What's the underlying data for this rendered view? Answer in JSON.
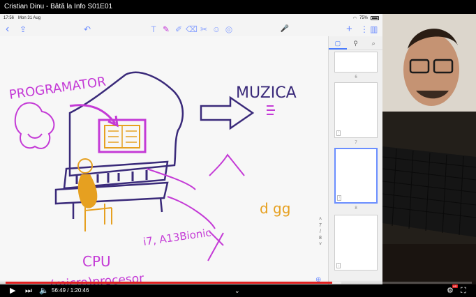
{
  "video": {
    "title": "Cristian Dinu - Bâtă la Info S01E01",
    "current_time": "56:49",
    "duration": "1:20:46",
    "played_fraction": 0.7,
    "loaded_fraction": 0.72
  },
  "ipad": {
    "status_time": "17:56",
    "status_date": "Mon 31 Aug",
    "battery": "75%"
  },
  "toolbar": {
    "back": "‹",
    "share": "⇪",
    "undo": "↶",
    "tools": [
      "T",
      "✎",
      "✐",
      "⌫",
      "✂",
      "☺",
      "◎"
    ],
    "mic": "🎤",
    "add": "+",
    "more": "⋮",
    "pages": "▥"
  },
  "sidebar": {
    "tabs": [
      "▢",
      "⚲",
      "⌕"
    ],
    "pages": [
      "6",
      "7",
      "8"
    ]
  },
  "pager": {
    "current": "7",
    "total": "8"
  },
  "drawing": {
    "programator": "PROGRAMATOR",
    "muzica": "MUZICA",
    "dgg": "d gg",
    "chips": "i7, A13Bionic",
    "cpu": "CPU",
    "processor": "(micro)procesor"
  },
  "colors": {
    "magenta": "#c43ad6",
    "purple": "#3a2a7a",
    "orange": "#e6a020",
    "accent": "#5b7cff",
    "played": "#e02020"
  }
}
